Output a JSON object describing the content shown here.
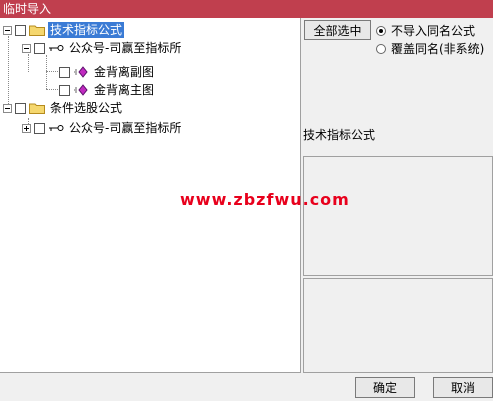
{
  "window": {
    "title": "临时导入"
  },
  "tree": {
    "items": [
      {
        "label": "技术指标公式"
      },
      {
        "label": "公众号-司赢至指标所"
      },
      {
        "label": "金背离副图"
      },
      {
        "label": "金背离主图"
      },
      {
        "label": "条件选股公式"
      },
      {
        "label": "公众号-司赢至指标所"
      }
    ]
  },
  "controls": {
    "select_all_label": "全部选中",
    "radio_no_import": "不导入同名公式",
    "radio_overwrite": "覆盖同名(非系统)",
    "section_label": "技术指标公式"
  },
  "watermark": {
    "text": "www.zbzfwu.com"
  },
  "footer": {
    "ok_label": "确定",
    "cancel_label": "取消"
  },
  "colors": {
    "title_bar": "#c03f4e",
    "selection": "#3a7bd5",
    "watermark": "#e8001c"
  }
}
